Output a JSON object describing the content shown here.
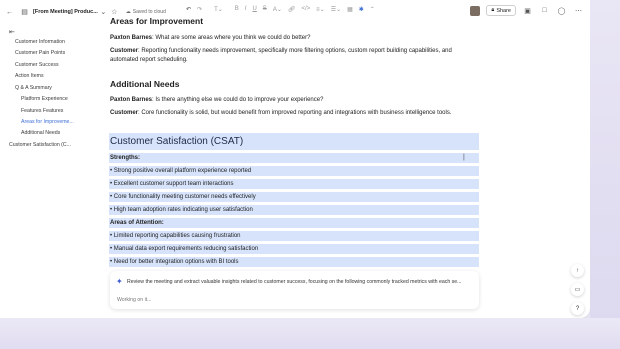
{
  "toolbar": {
    "doc_title": "[From Meeting] Produc...",
    "saved_status": "Saved to cloud",
    "share_label": "Share"
  },
  "sidebar": {
    "items": [
      {
        "label": "Customer Information",
        "active": false
      },
      {
        "label": "Customer Pain Points",
        "active": false
      },
      {
        "label": "Customer Success",
        "active": false
      },
      {
        "label": "Action Items",
        "active": false
      },
      {
        "label": "Q & A Summary",
        "active": false
      },
      {
        "label": "Platform Experience",
        "active": false
      },
      {
        "label": "Features Features",
        "active": false
      },
      {
        "label": "Areas for Improveme...",
        "active": true
      },
      {
        "label": "Additional Needs",
        "active": false
      },
      {
        "label": "Customer Satisfaction (C...",
        "active": false
      }
    ]
  },
  "content": {
    "areas_heading": "Areas for Improvement",
    "q1_speaker": "Paxton Barnes",
    "q1_text": ": What are some areas where you think we could do better?",
    "a1_speaker": "Customer",
    "a1_text": ": Reporting functionality needs improvement, specifically more filtering options, custom report building capabilities, and automated report scheduling.",
    "additional_heading": "Additional Needs",
    "q2_speaker": "Paxton Barnes",
    "q2_text": ": Is there anything else we could do to improve your experience?",
    "a2_speaker": "Customer",
    "a2_text": ": Core functionality is solid, but would benefit from improved reporting and integrations with business intelligence tools.",
    "csat_title": "Customer Satisfaction (CSAT)",
    "strengths_label": "Strengths:",
    "strengths": [
      "• Strong positive overall platform experience reported",
      "• Excellent customer support team interactions",
      "• Core functionality meeting customer needs effectively",
      "• High team adoption rates indicating user satisfaction"
    ],
    "attention_label": "Areas of Attention:",
    "attention": [
      "• Limited reporting capabilities causing frustration",
      "• Manual data export requirements reducing satisfaction",
      "• Need for better integration options with BI tools"
    ]
  },
  "prompt": {
    "text": "Review the meeting and extract valuable insights related to customer success, focusing on the following commonly tracked metrics with each se...",
    "status": "Working on it..."
  },
  "colors": {
    "highlight": "#d6e3fb",
    "accent": "#3d6fd6"
  }
}
